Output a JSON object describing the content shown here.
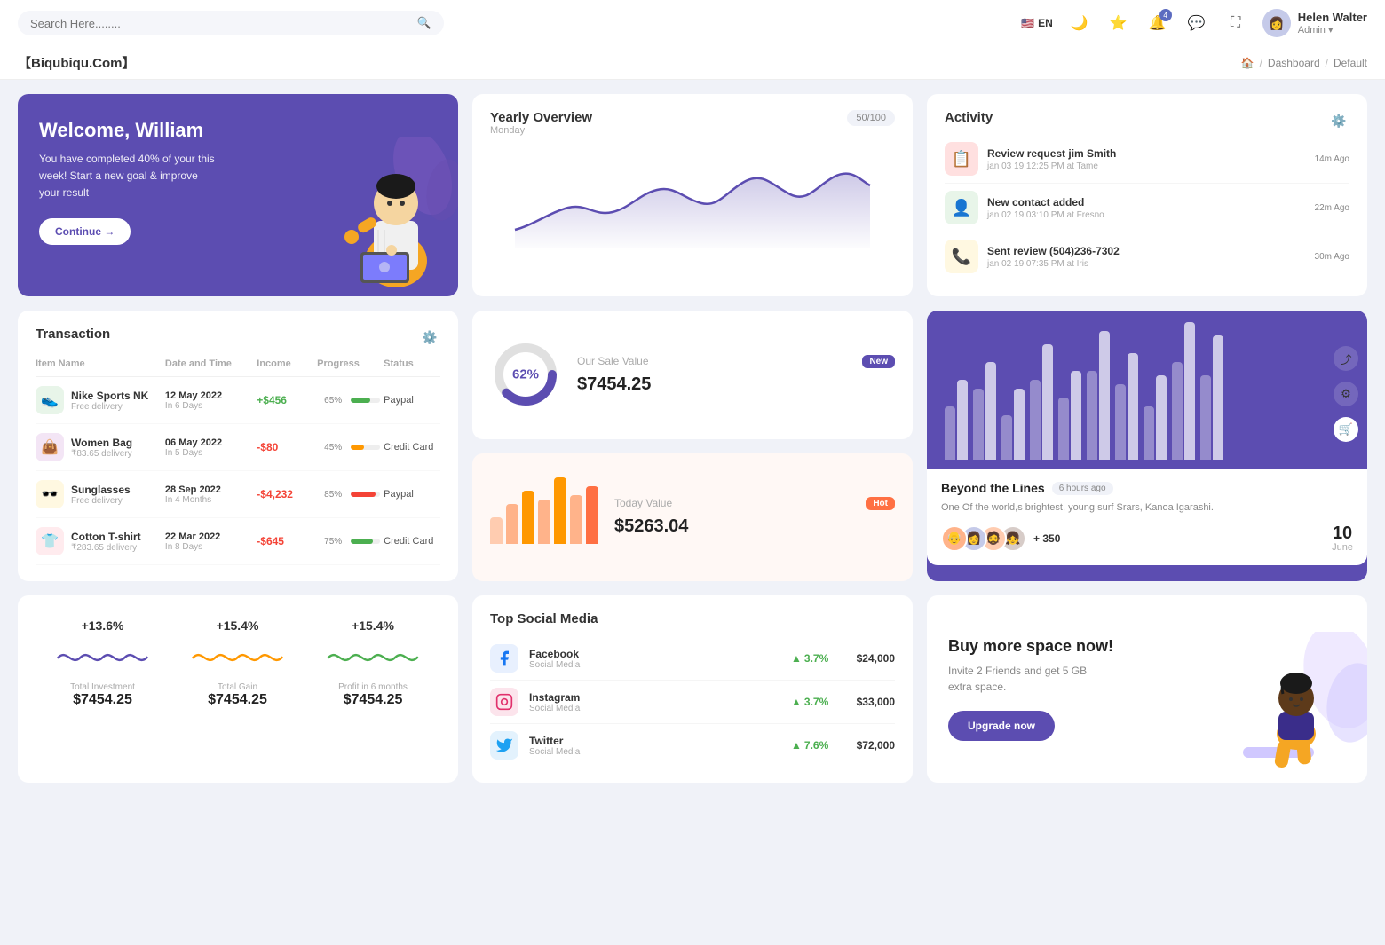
{
  "topbar": {
    "search_placeholder": "Search Here........",
    "lang": "EN",
    "user": {
      "name": "Helen Walter",
      "role": "Admin",
      "avatar_emoji": "👩"
    },
    "notification_count": "4"
  },
  "breadcrumb": {
    "brand": "【Biqubiqu.Com】",
    "home": "🏠",
    "items": [
      "Dashboard",
      "Default"
    ]
  },
  "welcome": {
    "title": "Welcome, William",
    "subtitle": "You have completed 40% of your this week! Start a new goal & improve your result",
    "button": "Continue →"
  },
  "yearly_overview": {
    "title": "Yearly Overview",
    "subtitle": "Monday",
    "badge": "50/100"
  },
  "activity": {
    "title": "Activity",
    "items": [
      {
        "title": "Review request jim Smith",
        "sub": "jan 03 19 12:25 PM at Tame",
        "time": "14m Ago",
        "emoji": "📋"
      },
      {
        "title": "New contact added",
        "sub": "jan 02 19 03:10 PM at Fresno",
        "time": "22m Ago",
        "emoji": "👤"
      },
      {
        "title": "Sent review (504)236-7302",
        "sub": "jan 02 19 07:35 PM at Iris",
        "time": "30m Ago",
        "emoji": "📞"
      }
    ]
  },
  "transaction": {
    "title": "Transaction",
    "headers": [
      "Item Name",
      "Date and Time",
      "Income",
      "Progress",
      "Status"
    ],
    "rows": [
      {
        "icon": "👟",
        "name": "Nike Sports NK",
        "sub": "Free delivery",
        "date": "12 May 2022",
        "date_sub": "In 6 Days",
        "income": "+$456",
        "income_type": "pos",
        "progress": 65,
        "progress_color": "#4caf50",
        "status": "Paypal"
      },
      {
        "icon": "👜",
        "name": "Women Bag",
        "sub": "₹83.65 delivery",
        "date": "06 May 2022",
        "date_sub": "In 5 Days",
        "income": "-$80",
        "income_type": "neg",
        "progress": 45,
        "progress_color": "#ff9800",
        "status": "Credit Card"
      },
      {
        "icon": "🕶️",
        "name": "Sunglasses",
        "sub": "Free delivery",
        "date": "28 Sep 2022",
        "date_sub": "In 4 Months",
        "income": "-$4,232",
        "income_type": "neg",
        "progress": 85,
        "progress_color": "#f44336",
        "status": "Paypal"
      },
      {
        "icon": "👕",
        "name": "Cotton T-shirt",
        "sub": "₹283.65 delivery",
        "date": "22 Mar 2022",
        "date_sub": "In 8 Days",
        "income": "-$645",
        "income_type": "neg",
        "progress": 75,
        "progress_color": "#4caf50",
        "status": "Credit Card"
      }
    ]
  },
  "sale_value": {
    "title": "Our Sale Value",
    "amount": "$7454.25",
    "percent": "62%",
    "badge": "New"
  },
  "today_value": {
    "title": "Today Value",
    "amount": "$5263.04",
    "badge": "Hot",
    "bars": [
      30,
      45,
      60,
      50,
      75,
      55,
      65
    ]
  },
  "bar_chart": {
    "title": "Beyond the Lines",
    "time_ago": "6 hours ago",
    "desc": "One Of the world,s brightest, young surf Srars, Kanoa Igarashi.",
    "plus_count": "+ 350",
    "date_num": "10",
    "date_month": "June",
    "bars": [
      {
        "h1": 60,
        "h2": 90
      },
      {
        "h1": 80,
        "h2": 110
      },
      {
        "h1": 50,
        "h2": 80
      },
      {
        "h1": 90,
        "h2": 130
      },
      {
        "h1": 70,
        "h2": 100
      },
      {
        "h1": 100,
        "h2": 145
      },
      {
        "h1": 85,
        "h2": 120
      },
      {
        "h1": 60,
        "h2": 95
      },
      {
        "h1": 110,
        "h2": 155
      },
      {
        "h1": 95,
        "h2": 140
      }
    ]
  },
  "stats": {
    "items": [
      {
        "pct": "+13.6%",
        "label": "Total Investment",
        "value": "$7454.25",
        "color": "#5c4db1",
        "wave_type": "purple"
      },
      {
        "pct": "+15.4%",
        "label": "Total Gain",
        "value": "$7454.25",
        "color": "#ff9800",
        "wave_type": "orange"
      },
      {
        "pct": "+15.4%",
        "label": "Profit in 6 months",
        "value": "$7454.25",
        "color": "#4caf50",
        "wave_type": "green"
      }
    ]
  },
  "social_media": {
    "title": "Top Social Media",
    "items": [
      {
        "name": "Facebook",
        "type": "Social Media",
        "icon": "🇫",
        "icon_bg": "#1877f2",
        "pct": "3.7%",
        "amount": "$24,000"
      },
      {
        "name": "Instagram",
        "type": "Social Media",
        "icon": "📷",
        "icon_bg": "#e1306c",
        "pct": "3.7%",
        "amount": "$33,000"
      },
      {
        "name": "Twitter",
        "type": "Social Media",
        "icon": "🐦",
        "icon_bg": "#1da1f2",
        "pct": "7.6%",
        "amount": "$72,000"
      }
    ]
  },
  "promo": {
    "title": "Buy more space now!",
    "sub": "Invite 2 Friends and get 5 GB extra space.",
    "button": "Upgrade now"
  },
  "icons": {
    "search": "🔍",
    "moon": "🌙",
    "star": "⭐",
    "bell": "🔔",
    "chat": "💬",
    "fullscreen": "⛶",
    "gear": "⚙️",
    "home": "🏠",
    "arrow_up": "▲",
    "cart": "🛒"
  }
}
